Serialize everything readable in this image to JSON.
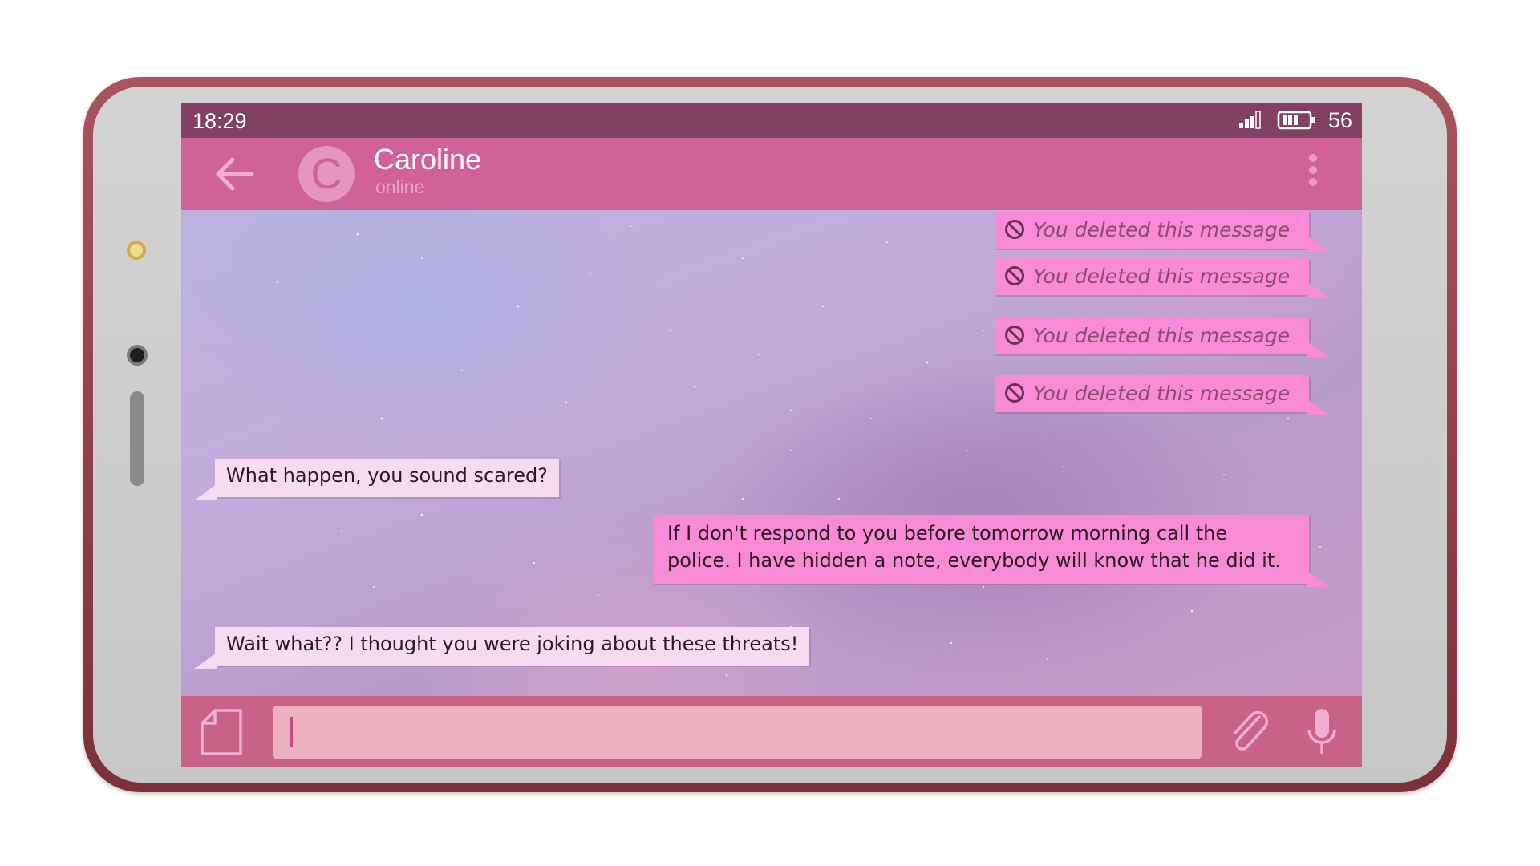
{
  "status_bar": {
    "time": "18:29",
    "battery_level": "56"
  },
  "header": {
    "avatar_letter": "C",
    "contact_name": "Caroline",
    "contact_status": "online"
  },
  "messages": [
    {
      "direction": "outgoing",
      "deleted": true,
      "text": "You deleted this message"
    },
    {
      "direction": "outgoing",
      "deleted": true,
      "text": "You deleted this message"
    },
    {
      "direction": "outgoing",
      "deleted": true,
      "text": "You deleted this message"
    },
    {
      "direction": "outgoing",
      "deleted": true,
      "text": "You deleted this message"
    },
    {
      "direction": "incoming",
      "deleted": false,
      "text": "What happen, you sound scared?"
    },
    {
      "direction": "outgoing",
      "deleted": false,
      "lines": [
        "If I don't respond to you before tomorrow morning call the",
        "police. I have hidden a note, everybody will know that he did it."
      ]
    },
    {
      "direction": "incoming",
      "deleted": false,
      "text": "Wait what?? I thought you were joking about these threats!"
    }
  ],
  "input": {
    "value": "",
    "placeholder": ""
  },
  "icons": {
    "back": "arrow-left-icon",
    "menu": "more-vertical-icon",
    "signal": "signal-icon",
    "battery": "battery-icon",
    "deleted": "ban-icon",
    "sticker": "sticker-icon",
    "attach": "paperclip-icon",
    "mic": "microphone-icon"
  },
  "colors": {
    "status_bar": "#804163",
    "app_bar": "#d06199",
    "outgoing_bubble": "#f98ad6",
    "incoming_bubble": "#f7dbf0",
    "input_bar": "#c96287",
    "input_field": "#ecb0c0",
    "phone_frame": "#9a4450"
  }
}
